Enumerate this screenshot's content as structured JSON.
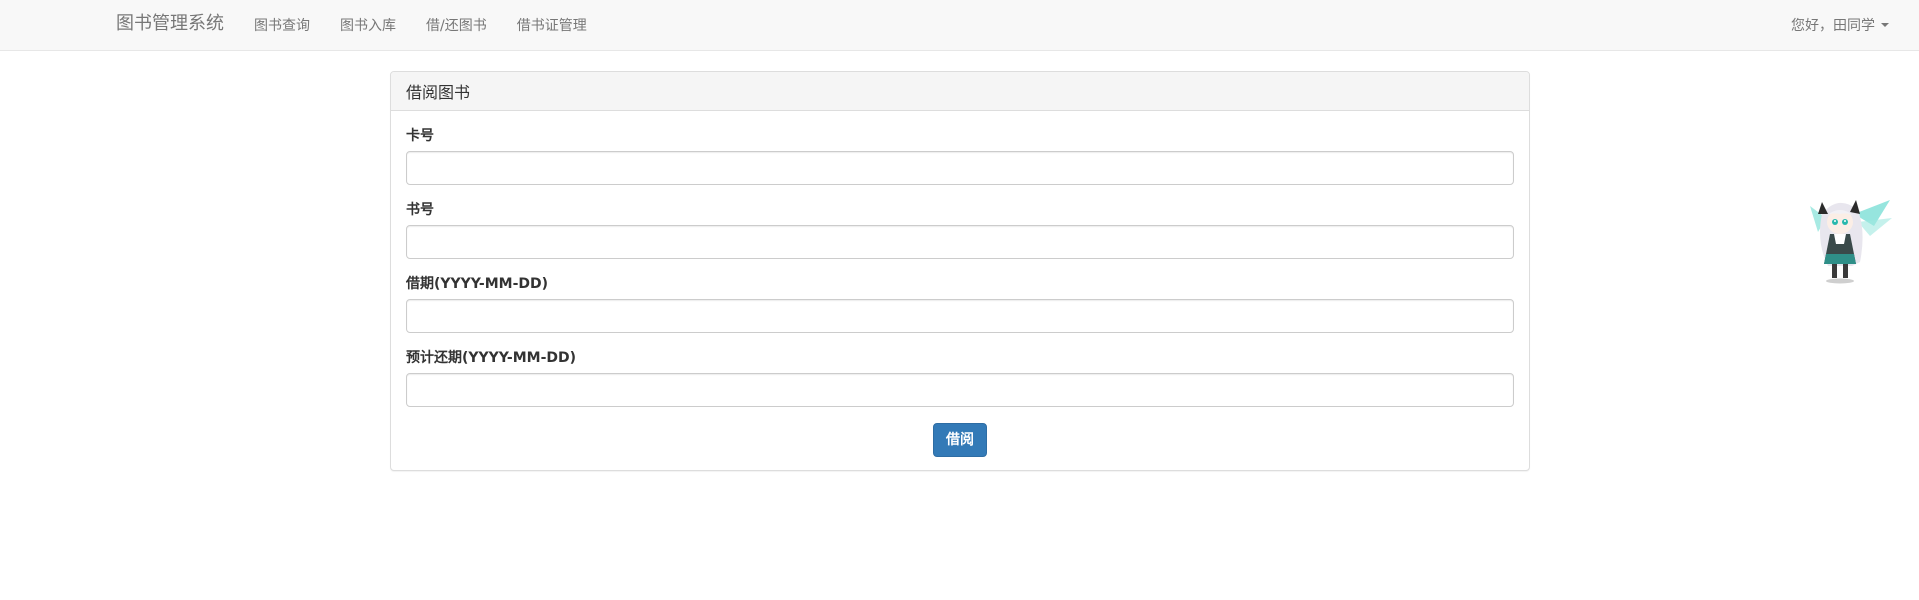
{
  "navbar": {
    "brand": "图书管理系统",
    "links": [
      {
        "label": "图书查询"
      },
      {
        "label": "图书入库"
      },
      {
        "label": "借/还图书"
      },
      {
        "label": "借书证管理"
      }
    ],
    "user_greeting": "您好，田同学"
  },
  "panel": {
    "title": "借阅图书",
    "fields": [
      {
        "label": "卡号",
        "value": "",
        "placeholder": ""
      },
      {
        "label": "书号",
        "value": "",
        "placeholder": ""
      },
      {
        "label": "借期(YYYY-MM-DD)",
        "value": "",
        "placeholder": ""
      },
      {
        "label": "预计还期(YYYY-MM-DD)",
        "value": "",
        "placeholder": ""
      }
    ],
    "submit_label": "借阅"
  },
  "colors": {
    "primary": "#337ab7",
    "navbar_bg": "#f8f8f8",
    "panel_heading_bg": "#f5f5f5",
    "mascot_accent": "#3fd0c2"
  },
  "icons": {
    "user_dropdown": "caret-down-icon",
    "decoration": "anime-mascot-image"
  }
}
